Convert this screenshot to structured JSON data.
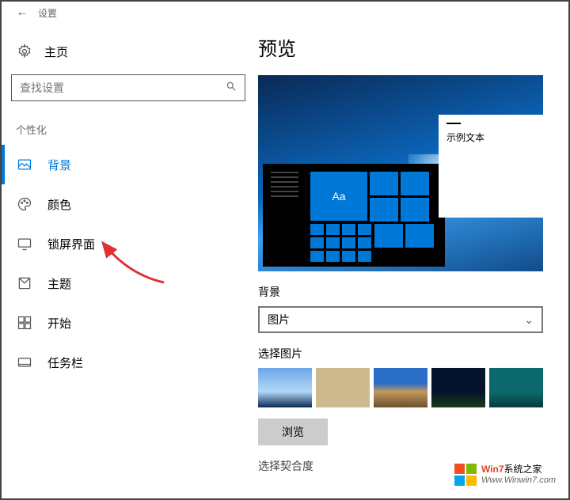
{
  "window": {
    "title": "设置",
    "back_aria": "返回"
  },
  "home_label": "主页",
  "search_placeholder": "查找设置",
  "section_title": "个性化",
  "nav": [
    {
      "id": "background",
      "label": "背景",
      "active": true
    },
    {
      "id": "colors",
      "label": "颜色",
      "active": false
    },
    {
      "id": "lockscreen",
      "label": "锁屏界面",
      "active": false
    },
    {
      "id": "themes",
      "label": "主题",
      "active": false
    },
    {
      "id": "start",
      "label": "开始",
      "active": false
    },
    {
      "id": "taskbar",
      "label": "任务栏",
      "active": false
    }
  ],
  "main": {
    "preview_title": "预览",
    "sample_text": "示例文本",
    "aa_label": "Aa",
    "background_label": "背景",
    "background_select_value": "图片",
    "choose_picture_label": "选择图片",
    "browse_label": "浏览",
    "choose_fit_label": "选择契合度"
  },
  "watermark": {
    "line1_prefix": "Win7",
    "line1_rest": "系统之家",
    "line2": "Www.Winwin7.com"
  }
}
